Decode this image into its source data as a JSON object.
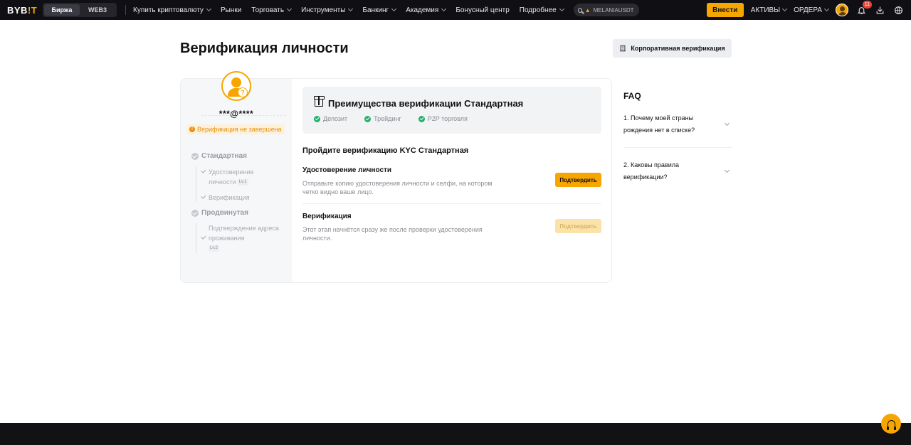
{
  "header": {
    "logo_main": "BYB",
    "logo_accent": "!T",
    "modes": [
      "Биржа",
      "WEB3"
    ],
    "nav": [
      {
        "label": "Купить криптовалюту",
        "dropdown": true
      },
      {
        "label": "Рынки",
        "dropdown": false
      },
      {
        "label": "Торговать",
        "dropdown": true
      },
      {
        "label": "Инструменты",
        "dropdown": true
      },
      {
        "label": "Банкинг",
        "dropdown": true
      },
      {
        "label": "Академия",
        "dropdown": true
      },
      {
        "label": "Бонусный центр",
        "dropdown": false
      },
      {
        "label": "Подробнее",
        "dropdown": true
      }
    ],
    "search_value": "MELANIAUSDT",
    "deposit_label": "Внести",
    "assets_label": "АКТИВЫ",
    "orders_label": "ОРДЕРА",
    "notification_count": "11"
  },
  "page": {
    "title": "Верификация личности",
    "corporate_button": "Корпоративная верификация"
  },
  "profile": {
    "masked_email": "***@****",
    "status": "Верификация не завершена"
  },
  "steps": {
    "standard": "Стандартная",
    "standard_sub1": "Удостоверение личности",
    "standard_sub1_level": "Lv.1",
    "standard_sub2": "Верификация",
    "advanced": "Продвинутая",
    "advanced_sub1": "Подтверждение адреса проживания",
    "advanced_sub1_level": "Lv.2"
  },
  "benefits": {
    "title": "Преимущества верификации Стандартная",
    "items": [
      "Депозит",
      "Трейдинг",
      "P2P торговля"
    ]
  },
  "kyc": {
    "heading": "Пройдите верификацию KYC Стандартная",
    "sections": [
      {
        "title": "Удостоверение личности",
        "description": "Отправьте копию удостоверения личности и селфи, на котором четко видно ваше лицо.",
        "button": "Подтвердить"
      },
      {
        "title": "Верификация",
        "description": "Этот этап начнётся сразу же после проверки удостоверения личности.",
        "button": "Подтвердить"
      }
    ]
  },
  "faq": {
    "title": "FAQ",
    "items": [
      "1. Почему моей страны рождения нет в списке?",
      "2. Каковы правила верификации?"
    ]
  },
  "colors": {
    "brand": "#f7a600",
    "success": "#20b26c",
    "warning": "#e6900b",
    "nav_bg": "#101014"
  }
}
